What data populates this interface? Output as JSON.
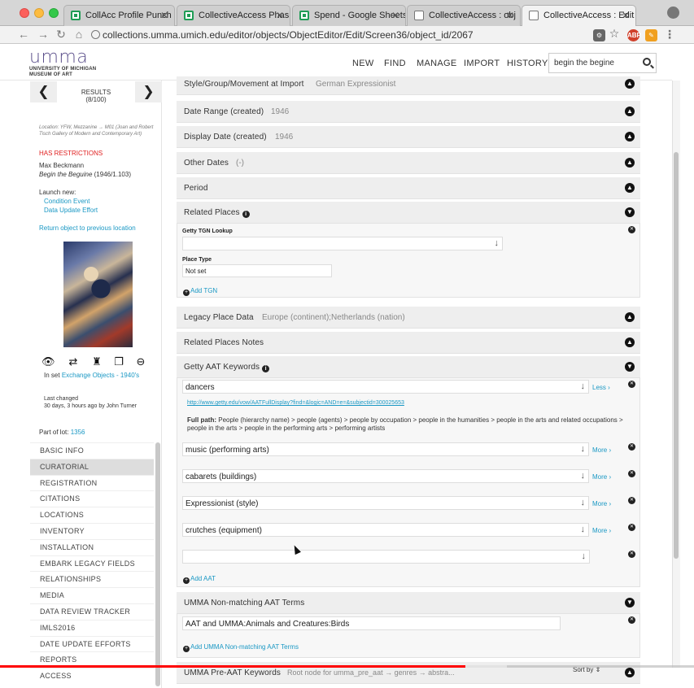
{
  "browser": {
    "tabs": [
      {
        "title": "CollAcc Profile Punch",
        "icon": "sheets-icon"
      },
      {
        "title": "CollectiveAccess Phas",
        "icon": "sheets-icon"
      },
      {
        "title": "Spend - Google Sheets",
        "icon": "sheets-icon"
      },
      {
        "title": "CollectiveAccess : obj",
        "icon": "doc-icon"
      },
      {
        "title": "CollectiveAccess : Edit",
        "icon": "doc-icon"
      }
    ],
    "url": "collections.umma.umich.edu/editor/objects/ObjectEditor/Edit/Screen36/object_id/2067"
  },
  "header": {
    "logo_word": "umma",
    "logo_sub1": "UNIVERSITY OF MICHIGAN",
    "logo_sub2": "MUSEUM OF ART",
    "nav": [
      "NEW",
      "FIND",
      "MANAGE",
      "IMPORT",
      "HISTORY"
    ],
    "search_value": "begin the begine"
  },
  "sidebar": {
    "results_label": "RESULTS",
    "results_count": "(8/100)",
    "location": "Location: YFW, Mezzanine → M01 (Joan and Robert Tisch Gallery of Modern and Contemporary Art)",
    "restrictions": "HAS RESTRICTIONS",
    "artist": "Max Beckmann",
    "work_title": "Begin the Beguine",
    "work_meta": "(1946/1.103)",
    "launch_new": "Launch new:",
    "launch_links": [
      "Condition Event",
      "Data Update Effort"
    ],
    "return_link": "Return object to previous location",
    "in_set_prefix": "In set",
    "in_set_link": "Exchange Objects - 1940's",
    "last_changed_label": "Last changed",
    "last_changed_value": "30 days, 3 hours ago by John Turner",
    "part_of_lot_label": "Part of lot:",
    "part_of_lot_value": "1356",
    "menu": [
      "BASIC INFO",
      "CURATORIAL",
      "REGISTRATION",
      "CITATIONS",
      "LOCATIONS",
      "INVENTORY",
      "INSTALLATION",
      "EMBARK LEGACY FIELDS",
      "RELATIONSHIPS",
      "MEDIA",
      "DATA REVIEW TRACKER",
      "IMLS2016",
      "DATE UPDATE EFFORTS",
      "REPORTS",
      "ACCESS"
    ],
    "active_menu": "CURATORIAL"
  },
  "main": {
    "style_row": {
      "label": "Style/Group/Movement at Import",
      "value": "German Expressionist"
    },
    "date_range": {
      "label": "Date Range (created)",
      "value": "1946"
    },
    "display_date": {
      "label": "Display Date (created)",
      "value": "1946"
    },
    "other_dates": {
      "label": "Other Dates",
      "value": "(-)"
    },
    "period": {
      "label": "Period"
    },
    "related_places": {
      "label": "Related Places",
      "tgn_label": "Getty TGN Lookup",
      "tgn_value": "",
      "place_type_label": "Place Type",
      "place_type_value": "Not set",
      "add_label": "Add TGN"
    },
    "legacy_place": {
      "label": "Legacy Place Data",
      "value": "Europe (continent);Netherlands (nation)"
    },
    "related_places_notes": {
      "label": "Related Places Notes"
    },
    "aat": {
      "label": "Getty AAT Keywords",
      "first_term": "dancers",
      "less_label": "Less",
      "url": "http://www.getty.edu/vow/AATFullDisplay?find=&logic=AND=e=&subjectid=300025653",
      "fullpath_label": "Full path:",
      "fullpath_value": "People (hierarchy name) > people (agents) > people by occupation > people in the humanities > people in the arts and related occupations > people in the arts > people in the performing arts > performing artists",
      "terms": [
        "music (performing arts)",
        "cabarets (buildings)",
        "Expressionist (style)",
        "crutches (equipment)"
      ],
      "more_label": "More",
      "empty_value": "",
      "add_label": "Add AAT"
    },
    "non_matching": {
      "label": "UMMA Non-matching AAT Terms",
      "value": "AAT and UMMA:Animals and Creatures:Birds",
      "add_label": "Add UMMA Non-matching AAT Terms"
    },
    "pre_aat": {
      "label": "UMMA Pre-AAT Keywords",
      "value": "Root node for umma_pre_aat → genres → abstra...",
      "sort_label": "Sort by"
    }
  },
  "video": {
    "progress": 0.67,
    "buffered_to": 0.73
  }
}
